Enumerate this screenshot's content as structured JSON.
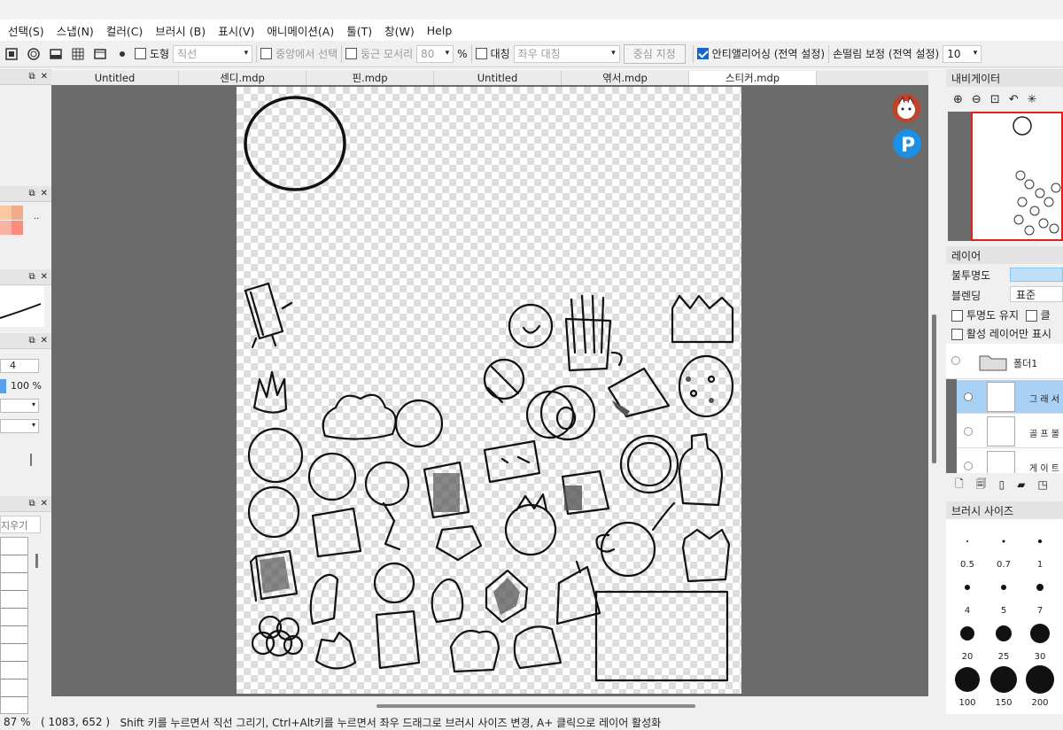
{
  "menu": [
    "선택(S)",
    "스냅(N)",
    "컬러(C)",
    "브러시 (B)",
    "표시(V)",
    "애니메이션(A)",
    "툴(T)",
    "창(W)",
    "Help"
  ],
  "toolbar": {
    "shape_label": "도형",
    "shape_value": "직선",
    "center_select_label": "중앙에서 선택",
    "round_corner_label": "둥근 모서리",
    "round_corner_value": "80",
    "percent": "%",
    "symmetry_label": "대칭",
    "symmetry_value": "좌우 대칭",
    "center_btn": "중심 지정",
    "antialias_label": "안티앨리어싱 (전역 설정)",
    "stabilizer_label": "손떨림 보정 (전역 설정)",
    "stabilizer_value": "10"
  },
  "tabs": [
    "Untitled",
    "센디.mdp",
    "핀.mdp",
    "Untitled",
    "엮서.mdp",
    "스티커.mdp"
  ],
  "active_tab": 5,
  "left_panel": {
    "value_4": "4",
    "opacity": "100 %",
    "eraser_label": "지우기"
  },
  "right_panel": {
    "navigator_title": "내비게이터",
    "layer_title": "레이어",
    "opacity_label": "불투명도",
    "blend_label": "블렌딩",
    "blend_value": "표준",
    "keep_opacity": "투명도 유지",
    "clip_label": "클",
    "active_only": "활성 레이어만 표시",
    "folder_name": "폴더1",
    "layer1": "그 래 서",
    "layer2": "골 프 볼",
    "layer3": "게 이 트",
    "brush_size_title": "브러시 사이즈",
    "brush_sizes": [
      "0.5",
      "0.7",
      "1",
      "4",
      "5",
      "7",
      "20",
      "25",
      "30",
      "100",
      "150",
      "200"
    ]
  },
  "status": {
    "zoom": "87 %",
    "coords": "( 1083, 652 )",
    "hint": "Shift 키를 누르면서 직선 그리기, Ctrl+Alt키를 누르면서 좌우 드래그로 브러시 사이즈 변경, A+ 클릭으로 레이어 활성화"
  },
  "colors": {
    "swatch1": "#f9c8a0",
    "swatch2": "#f3a98a",
    "swatch3": "#f7b3a4",
    "swatch4": "#ff8a7a",
    "accent": "#1a66c6",
    "selected_layer": "#a9d1f5"
  }
}
